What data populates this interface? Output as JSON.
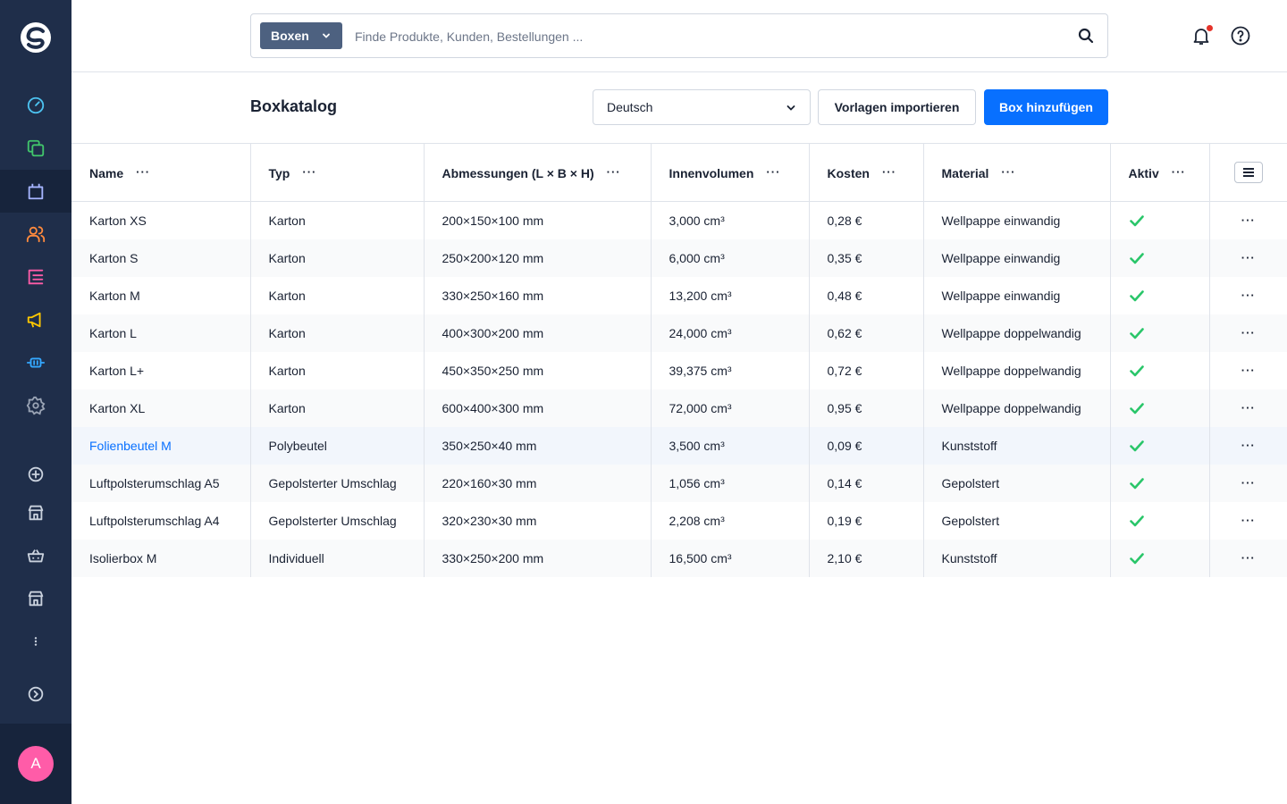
{
  "search": {
    "type_label": "Boxen",
    "placeholder": "Finde Produkte, Kunden, Bestellungen ..."
  },
  "sidebar": {
    "avatar_initial": "A",
    "items": [
      {
        "icon": "dashboard-icon",
        "color": "#4cc2f0"
      },
      {
        "icon": "catalogues-icon",
        "color": "#41c56b"
      },
      {
        "icon": "orders-bag-icon",
        "color": "#a6b5ff",
        "active": true
      },
      {
        "icon": "customers-icon",
        "color": "#ff8a3d"
      },
      {
        "icon": "content-icon",
        "color": "#ff5ca8"
      },
      {
        "icon": "marketing-icon",
        "color": "#ffc800"
      },
      {
        "icon": "extensions-icon",
        "color": "#34a8ff"
      },
      {
        "icon": "settings-icon",
        "color": "#9aa4b5"
      },
      {
        "icon": "add-circle-icon",
        "color": "#c9d1dd"
      },
      {
        "icon": "storefront-icon",
        "color": "#c9d1dd"
      },
      {
        "icon": "basket-icon",
        "color": "#c9d1dd"
      },
      {
        "icon": "storefront-2-icon",
        "color": "#c9d1dd"
      },
      {
        "icon": "more-vertical-icon",
        "color": "#c9d1dd"
      },
      {
        "icon": "expand-sidebar-icon",
        "color": "#c9d1dd"
      }
    ]
  },
  "header": {
    "title": "Boxkatalog",
    "language": "Deutsch",
    "import_label": "Vorlagen importieren",
    "add_label": "Box hinzufügen"
  },
  "table": {
    "columns": [
      "Name",
      "Typ",
      "Abmessungen (L × B × H)",
      "Innenvolumen",
      "Kosten",
      "Material",
      "Aktiv"
    ],
    "column_menu": "···",
    "row_menu": "···",
    "active_color": "#2ac66a",
    "link_color": "#0870ff",
    "rows": [
      {
        "name": "Karton XS",
        "type": "Karton",
        "dims": "200×150×100 mm",
        "volume": "3,000 cm³",
        "cost": "0,28 €",
        "material": "Wellpappe einwandig",
        "active": true
      },
      {
        "name": "Karton S",
        "type": "Karton",
        "dims": "250×200×120 mm",
        "volume": "6,000 cm³",
        "cost": "0,35 €",
        "material": "Wellpappe einwandig",
        "active": true
      },
      {
        "name": "Karton M",
        "type": "Karton",
        "dims": "330×250×160 mm",
        "volume": "13,200 cm³",
        "cost": "0,48 €",
        "material": "Wellpappe einwandig",
        "active": true
      },
      {
        "name": "Karton L",
        "type": "Karton",
        "dims": "400×300×200 mm",
        "volume": "24,000 cm³",
        "cost": "0,62 €",
        "material": "Wellpappe doppelwandig",
        "active": true
      },
      {
        "name": "Karton L+",
        "type": "Karton",
        "dims": "450×350×250 mm",
        "volume": "39,375 cm³",
        "cost": "0,72 €",
        "material": "Wellpappe doppelwandig",
        "active": true
      },
      {
        "name": "Karton XL",
        "type": "Karton",
        "dims": "600×400×300 mm",
        "volume": "72,000 cm³",
        "cost": "0,95 €",
        "material": "Wellpappe doppelwandig",
        "active": true
      },
      {
        "name": "Folienbeutel M",
        "type": "Polybeutel",
        "dims": "350×250×40 mm",
        "volume": "3,500 cm³",
        "cost": "0,09 €",
        "material": "Kunststoff",
        "active": true,
        "highlighted": true
      },
      {
        "name": "Luftpolsterumschlag A5",
        "type": "Gepolsterter Umschlag",
        "dims": "220×160×30 mm",
        "volume": "1,056 cm³",
        "cost": "0,14 €",
        "material": "Gepolstert",
        "active": true
      },
      {
        "name": "Luftpolsterumschlag A4",
        "type": "Gepolsterter Umschlag",
        "dims": "320×230×30 mm",
        "volume": "2,208 cm³",
        "cost": "0,19 €",
        "material": "Gepolstert",
        "active": true
      },
      {
        "name": "Isolierbox M",
        "type": "Individuell",
        "dims": "330×250×200 mm",
        "volume": "16,500 cm³",
        "cost": "2,10 €",
        "material": "Kunststoff",
        "active": true
      }
    ]
  }
}
